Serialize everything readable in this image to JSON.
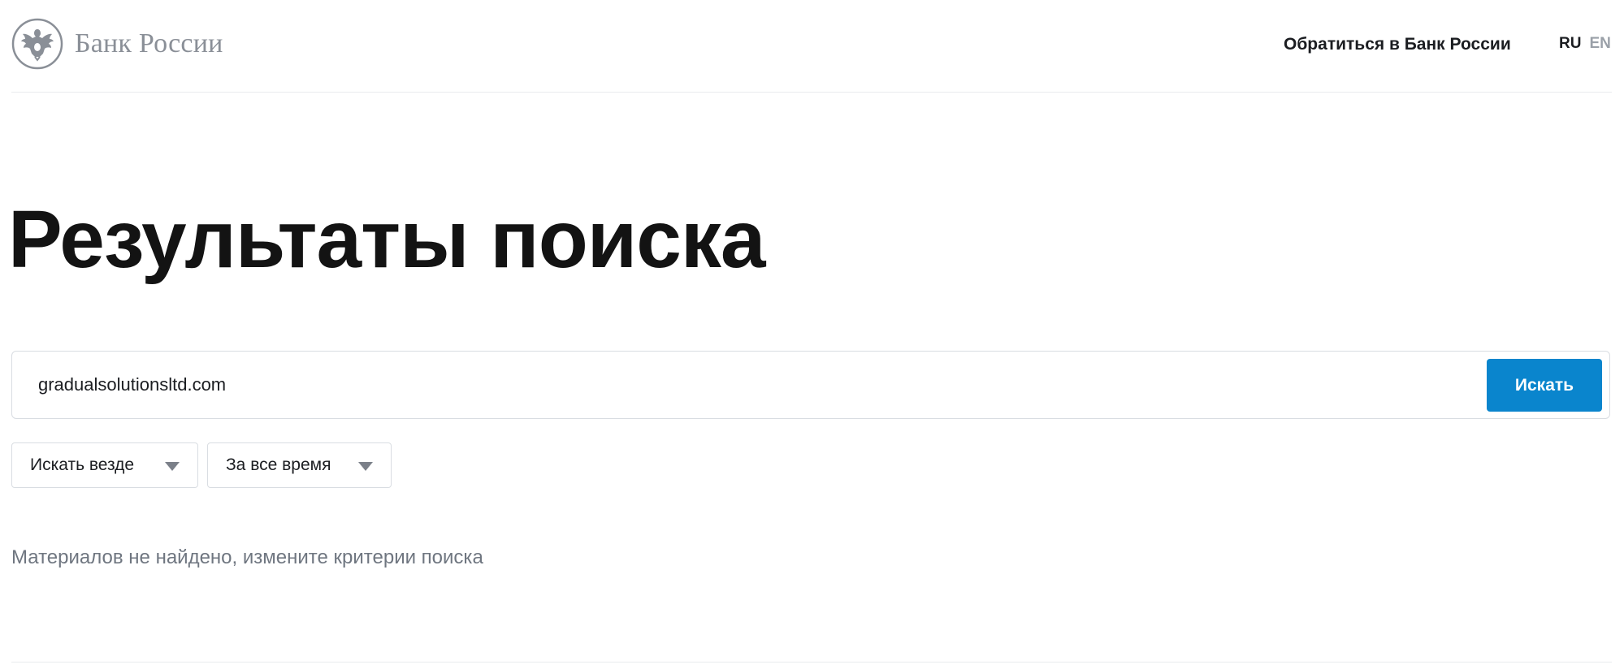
{
  "header": {
    "logo_text": "Банк России",
    "contact_link": "Обратиться в Банк России",
    "lang_ru": "RU",
    "lang_en": "EN"
  },
  "page": {
    "title": "Результаты поиска"
  },
  "search": {
    "query": "gradualsolutionsltd.com",
    "button_label": "Искать"
  },
  "filters": {
    "scope": "Искать везде",
    "period": "За все время"
  },
  "results": {
    "message": "Материалов не найдено, измените критерии поиска"
  },
  "colors": {
    "accent": "#0a85cd",
    "muted_text": "#6f7680",
    "logo_gray": "#8a8f97"
  },
  "icons": {
    "logo": "bank-of-russia-emblem-icon",
    "dropdown": "triangle-down-icon"
  }
}
